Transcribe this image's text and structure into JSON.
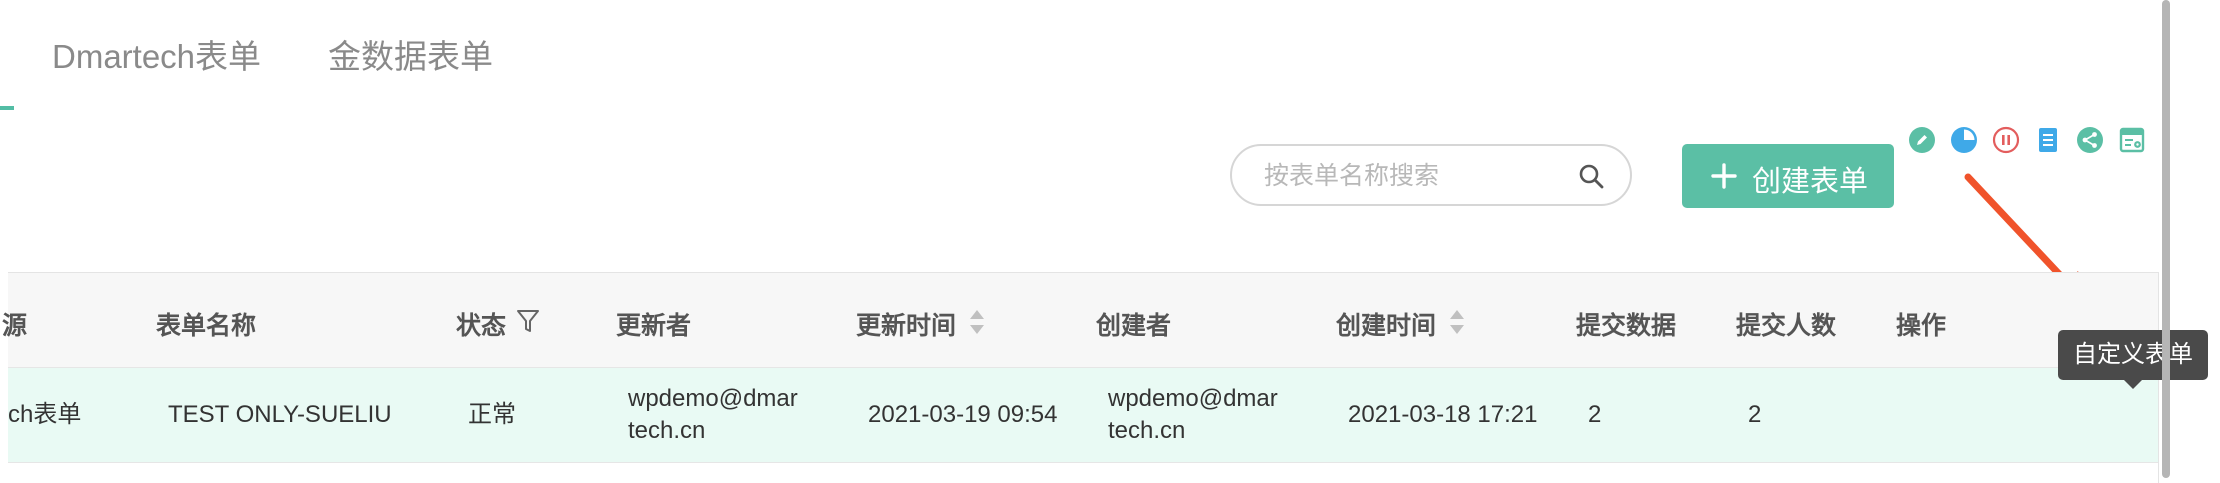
{
  "tabs": [
    {
      "label": "Dmartech表单"
    },
    {
      "label": "金数据表单"
    }
  ],
  "search": {
    "placeholder": "按表单名称搜索",
    "value": ""
  },
  "create_button": {
    "label": "创建表单"
  },
  "table": {
    "columns": {
      "source_partial": "源",
      "form_name": "表单名称",
      "status": "状态",
      "updater": "更新者",
      "update_time": "更新时间",
      "creator": "创建者",
      "create_time": "创建时间",
      "submissions": "提交数据",
      "submitters": "提交人数",
      "actions": "操作"
    },
    "rows": [
      {
        "source_partial": "ch表单",
        "form_name": "TEST ONLY-SUELIU",
        "status": "正常",
        "updater_line1": "wpdemo@dmar",
        "updater_line2": "tech.cn",
        "update_time": "2021-03-19 09:54",
        "creator_line1": "wpdemo@dmar",
        "creator_line2": "tech.cn",
        "create_time": "2021-03-18 17:21",
        "submissions": "2",
        "submitters": "2"
      }
    ]
  },
  "row_actions": [
    {
      "icon": "edit-icon",
      "color": "#5bbfa5"
    },
    {
      "icon": "pie-chart-icon",
      "color": "#3fa9e8"
    },
    {
      "icon": "pause-icon",
      "color": "#e35d5d"
    },
    {
      "icon": "document-icon",
      "color": "#3fa9e8"
    },
    {
      "icon": "share-icon",
      "color": "#5bbfa5"
    },
    {
      "icon": "custom-form-icon",
      "color": "#5bbfa5"
    }
  ],
  "tooltip": {
    "text": "自定义表单"
  },
  "colors": {
    "accent": "#5bbfa5",
    "row_highlight": "#e9faf4",
    "annotation_arrow": "#f0532b"
  }
}
